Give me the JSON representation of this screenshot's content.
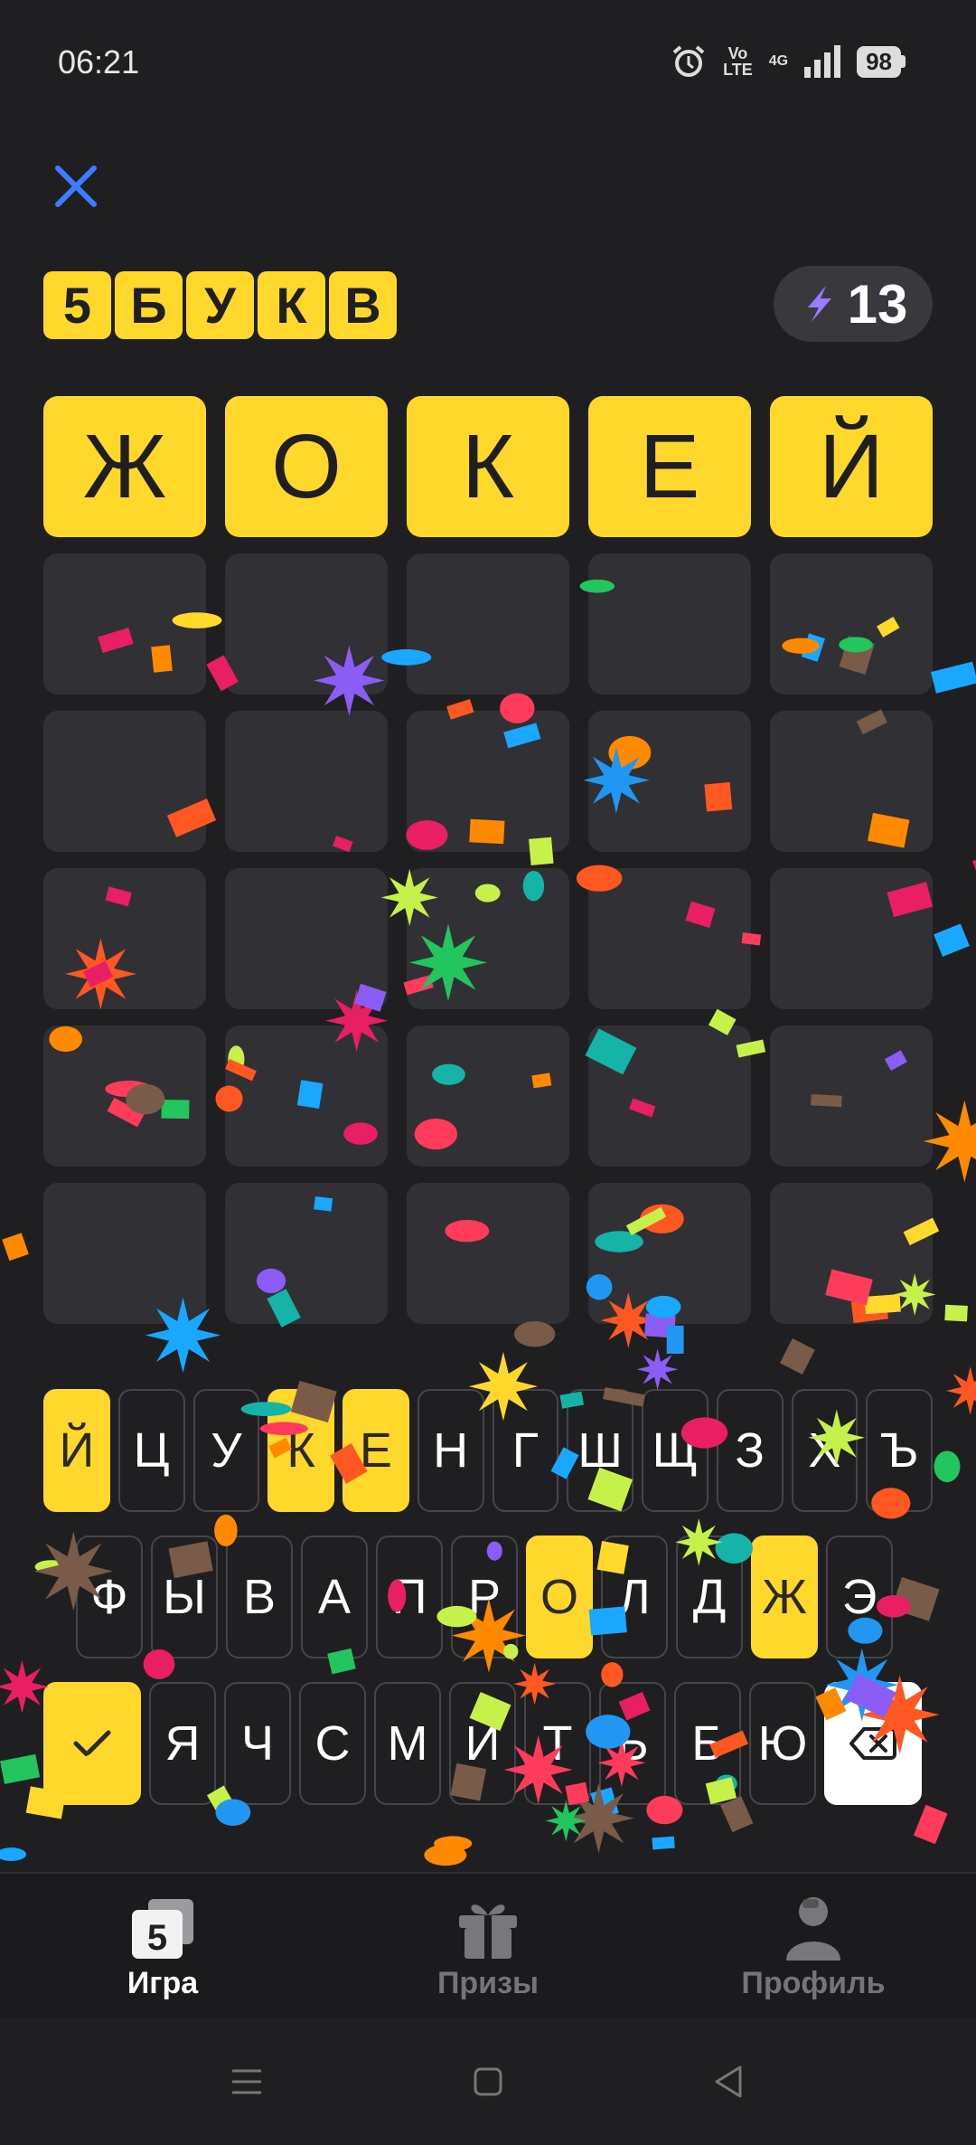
{
  "status": {
    "time": "06:21",
    "volte": [
      "Vo",
      "LTE"
    ],
    "network": "4G",
    "battery": "98"
  },
  "header": {
    "logo_letters": [
      "5",
      "Б",
      "У",
      "К",
      "В"
    ],
    "score": "13"
  },
  "board": {
    "rows": [
      [
        "Ж",
        "О",
        "К",
        "Е",
        "Й"
      ],
      [
        "",
        "",
        "",
        "",
        ""
      ],
      [
        "",
        "",
        "",
        "",
        ""
      ],
      [
        "",
        "",
        "",
        "",
        ""
      ],
      [
        "",
        "",
        "",
        "",
        ""
      ],
      [
        "",
        "",
        "",
        "",
        ""
      ]
    ],
    "solved_row": 0
  },
  "keyboard": {
    "row1": [
      "Й",
      "Ц",
      "У",
      "К",
      "Е",
      "Н",
      "Г",
      "Ш",
      "Щ",
      "З",
      "Х",
      "Ъ"
    ],
    "row2": [
      "Ф",
      "Ы",
      "В",
      "А",
      "П",
      "Р",
      "О",
      "Л",
      "Д",
      "Ж",
      "Э"
    ],
    "row3": [
      "Я",
      "Ч",
      "С",
      "М",
      "И",
      "Т",
      "Ь",
      "Б",
      "Ю"
    ],
    "highlighted": [
      "Й",
      "К",
      "Е",
      "О",
      "Ж"
    ]
  },
  "tabs": {
    "game": "Игра",
    "prizes": "Призы",
    "profile": "Профиль",
    "game_icon_text": "5"
  },
  "colors": {
    "accent": "#ffd82b",
    "background": "#1f1f21",
    "cell_empty": "#313135",
    "score_bolt": "#9b7cff"
  }
}
